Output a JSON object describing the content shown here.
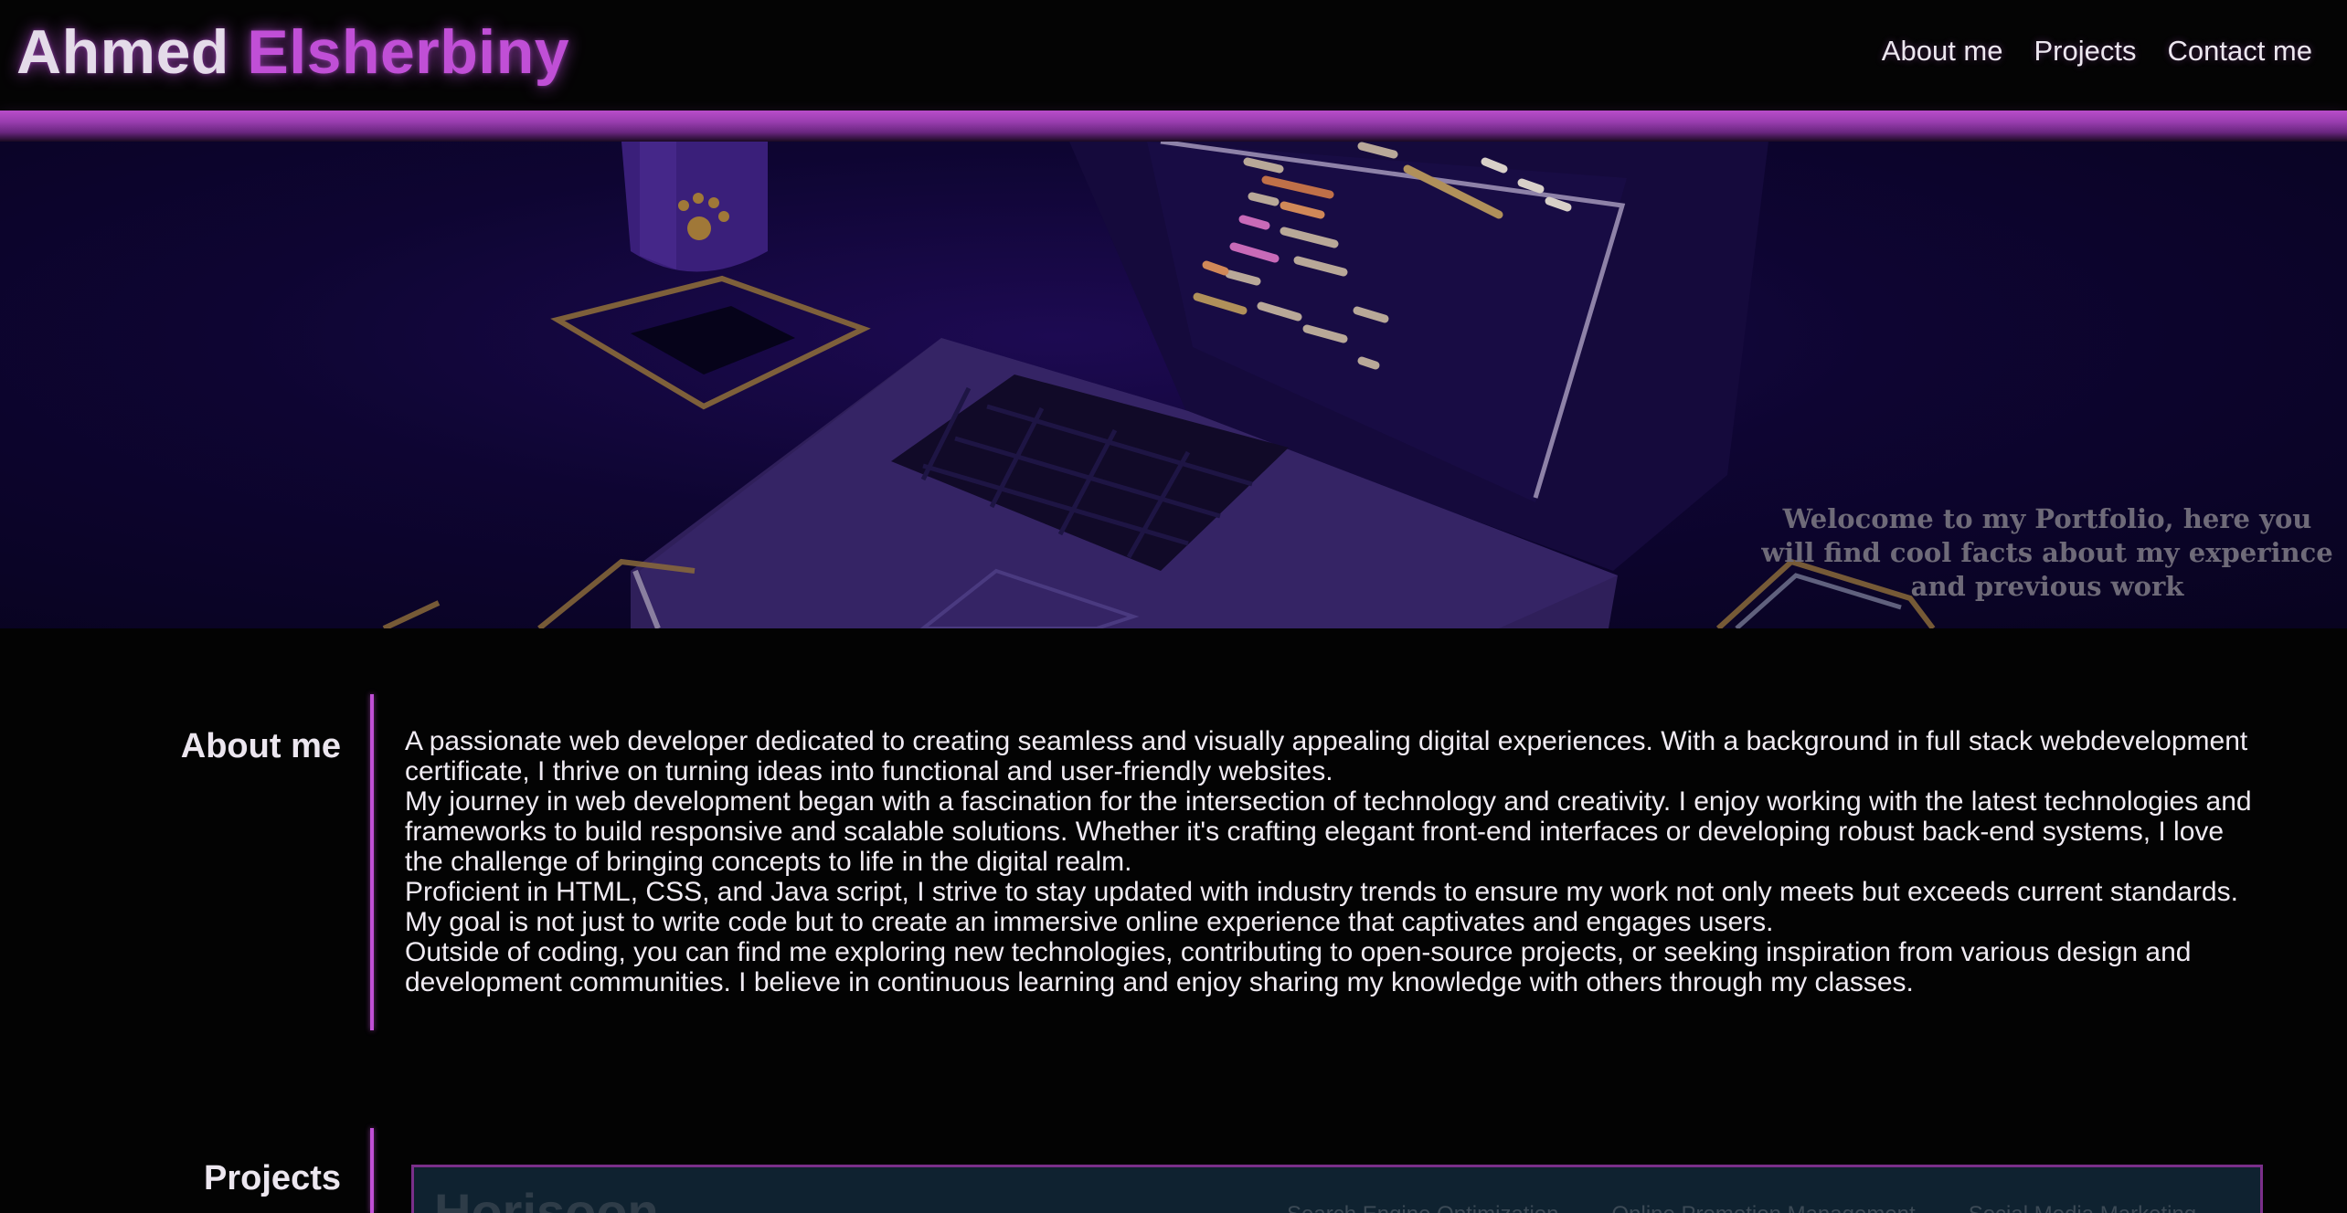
{
  "header": {
    "first_name": "Ahmed",
    "last_name": "Elsherbiny",
    "nav": [
      "About me",
      "Projects",
      "Contact me"
    ]
  },
  "hero": {
    "welcome": "Welocome to my Portfolio, here you will find cool facts about my experince and previous work"
  },
  "about": {
    "title": "About me",
    "paragraphs": [
      "A passionate web developer dedicated to creating seamless and visually appealing digital experiences. With a background in full stack webdevelopment certificate, I thrive on turning ideas into functional and user-friendly websites.",
      "My journey in web development began with a fascination for the intersection of technology and creativity. I enjoy working with the latest technologies and frameworks to build responsive and scalable solutions. Whether it's crafting elegant front-end interfaces or developing robust back-end systems, I love the challenge of bringing concepts to life in the digital realm.",
      "Proficient in HTML, CSS, and Java script, I strive to stay updated with industry trends to ensure my work not only meets but exceeds current standards. My goal is not just to write code but to create an immersive online experience that captivates and engages users.",
      "Outside of coding, you can find me exploring new technologies, contributing to open-source projects, or seeking inspiration from various design and development communities. I believe in continuous learning and enjoy sharing my knowledge with others through my classes."
    ]
  },
  "projects": {
    "title": "Projects",
    "cards": [
      {
        "title": "Horisoon",
        "tags": [
          "Search Engine Optimization",
          "Online Promotion Management",
          "Social Media Marketing"
        ]
      }
    ]
  },
  "colors": {
    "accent": "#c04fd6",
    "background": "#030303",
    "hero_bg": "#0e0532"
  }
}
